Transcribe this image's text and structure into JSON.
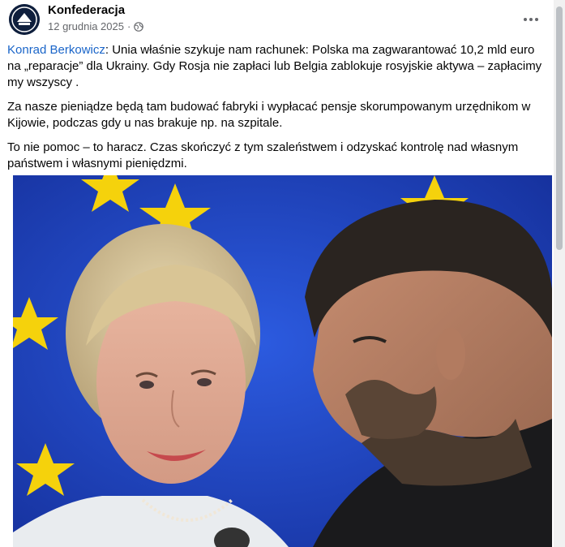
{
  "post": {
    "author": "Konfederacja",
    "date": "12 grudnia 2025",
    "separator": "·",
    "visibility_icon": "globe-icon",
    "more_icon": "more-options-icon",
    "mention": "Konrad Berkowicz",
    "paragraph1": ": Unia właśnie szykuje nam rachunek: Polska ma zagwarantować 10,2 mld euro na „reparacje” dla Ukrainy. Gdy Rosja nie zapłaci lub Belgia zablokuje rosyjskie aktywa – zapłacimy my wszyscy .",
    "paragraph2": "Za nasze pieniądze będą tam budować fabryki i wypłacać pensje skorumpowanym urzędnikom w Kijowie, podczas gdy u nas brakuje np. na szpitale.",
    "paragraph3": "To nie pomoc – to haracz. Czas skończyć z tym szaleństwem i odzyskać kontrolę nad własnym państwem i własnymi pieniędzmi."
  },
  "colors": {
    "mention": "#1a65c9",
    "eu_blue": "#2045c0",
    "eu_star": "#f5d20c",
    "meta_gray": "#65676b"
  }
}
